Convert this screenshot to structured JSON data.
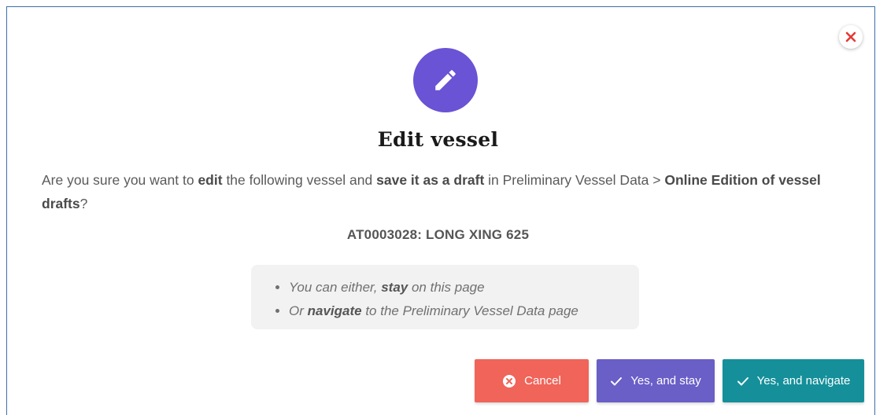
{
  "dialog": {
    "title": "Edit vessel",
    "message": {
      "part1": "Are you sure you want to ",
      "edit": "edit",
      "part2": " the following vessel and ",
      "save_draft": "save it as a draft",
      "part3": " in Preliminary Vessel Data > ",
      "online_edition": "Online Edition of vessel drafts",
      "part4": "?"
    },
    "vessel_id": "AT0003028: LONG XING 625",
    "options": {
      "item1_pre": "You can either, ",
      "item1_bold": "stay",
      "item1_post": " on this page",
      "item2_pre": "Or ",
      "item2_bold": "navigate",
      "item2_post": " to the Preliminary Vessel Data page"
    },
    "buttons": {
      "cancel_label": "Cancel",
      "stay_label": "Yes, and stay",
      "navigate_label": "Yes, and navigate"
    },
    "icons": {
      "header": "pencil-icon",
      "close": "close-icon",
      "cancel": "cancel-circle-icon",
      "confirm": "check-icon"
    },
    "colors": {
      "header_circle": "#6a53d4",
      "close_x": "#e53935",
      "cancel_button": "#f0645a",
      "stay_button": "#6a5ec7",
      "navigate_button": "#15909a",
      "frame_border": "#3f6fa8"
    }
  }
}
